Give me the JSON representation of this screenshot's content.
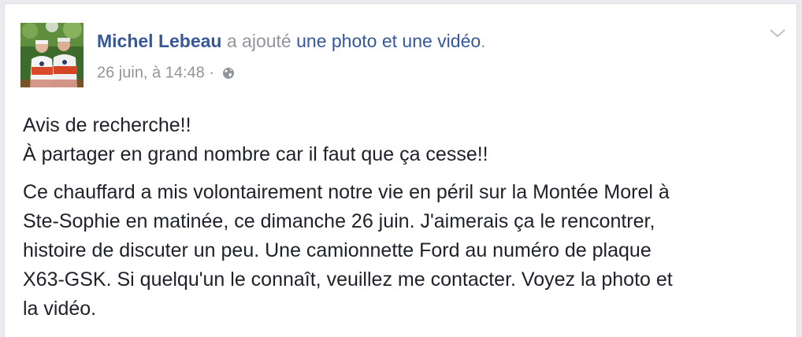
{
  "post": {
    "author": "Michel Lebeau",
    "action": "a ajouté",
    "object": "une photo et une vidéo",
    "period": ".",
    "timestamp": "26 juin, à 14:48",
    "separator": "·",
    "privacy_icon": "globe-icon",
    "options_icon": "chevron-down-icon",
    "avatar": "profile-photo",
    "paragraphs": [
      {
        "lines": [
          "Avis de recherche!!",
          "À partager en grand nombre car il faut que ça cesse!!"
        ]
      },
      {
        "lines": [
          "Ce chauffard a mis volontairement notre vie en péril sur la Montée Morel à",
          "Ste-Sophie en matinée, ce dimanche 26 juin. J'aimerais ça le rencontrer,",
          "histoire de discuter un peu. Une camionnette Ford au numéro de plaque",
          "X63-GSK. Si quelqu'un le connaît, veuillez me contacter. Voyez la photo et",
          "la vidéo."
        ]
      }
    ]
  },
  "colors": {
    "link": "#365899",
    "meta": "#90949c",
    "text": "#1d2129",
    "background": "#e9ebee",
    "card": "#ffffff"
  }
}
